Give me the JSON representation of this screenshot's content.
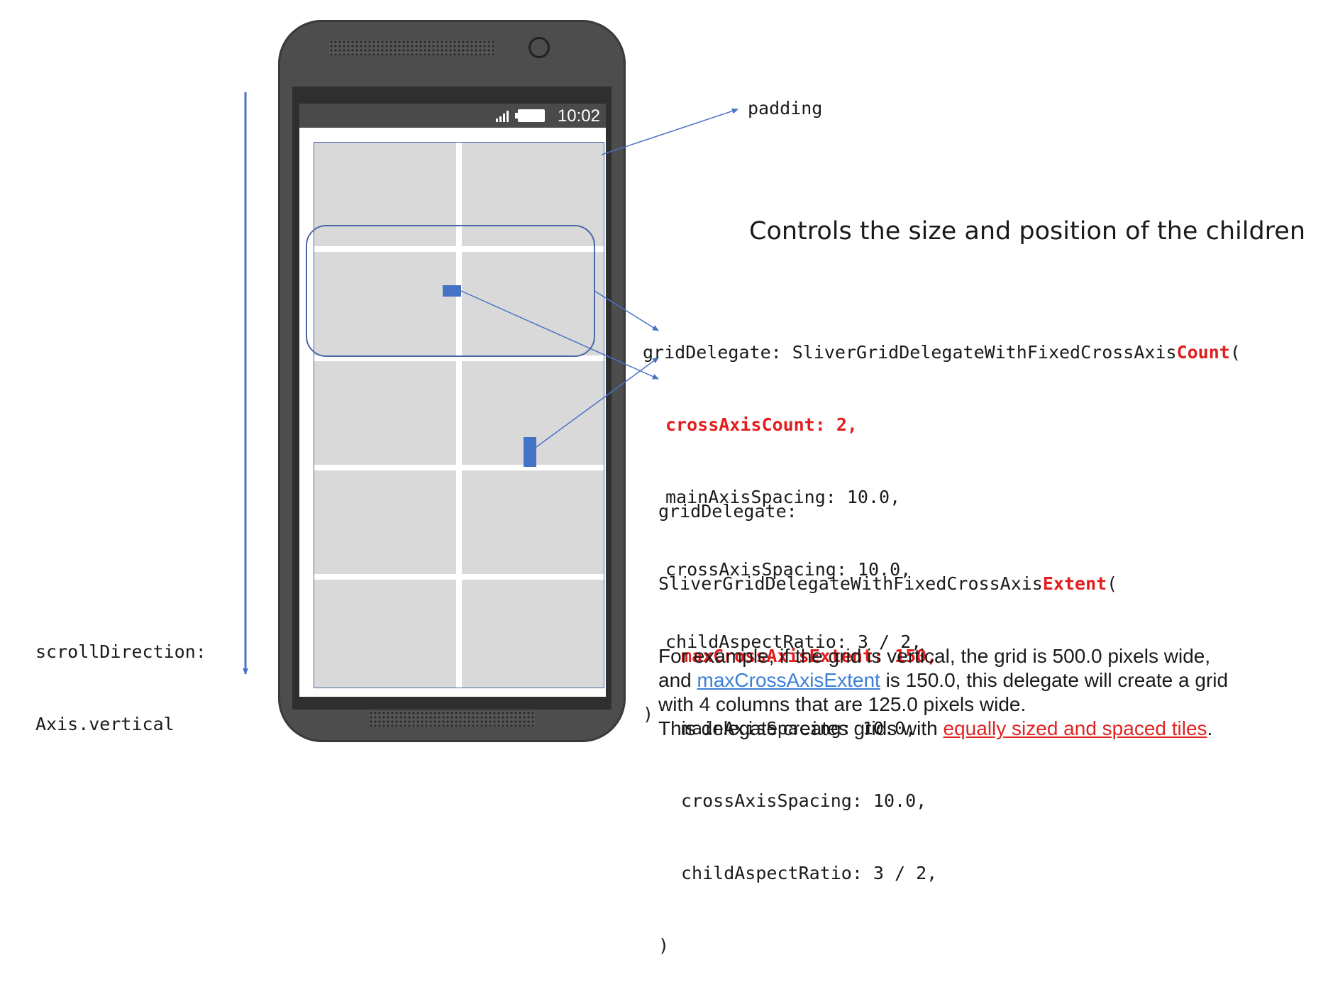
{
  "phone": {
    "status_time": "10:02"
  },
  "labels": {
    "padding": "padding",
    "heading": "Controls the size and position of the children",
    "scroll_line1": "scrollDirection:",
    "scroll_line2": "Axis.vertical"
  },
  "code_count": {
    "l1_a": "gridDelegate: SliverGridDelegateWithFixedCrossAxis",
    "l1_b": "Count",
    "l1_c": "(",
    "l2": "crossAxisCount: 2,",
    "l3": "mainAxisSpacing: 10.0,",
    "l4": "crossAxisSpacing: 10.0,",
    "l5": "childAspectRatio: 3 / 2,",
    "l6": ")"
  },
  "code_extent": {
    "l1": "gridDelegate:",
    "l2_a": "SliverGridDelegateWithFixedCrossAxis",
    "l2_b": "Extent",
    "l2_c": "(",
    "l3": "maxCrossAxisExtent: 150,",
    "l4": "mainAxisSpacing: 10.0,",
    "l5": "crossAxisSpacing: 10.0,",
    "l6": "childAspectRatio: 3 / 2,",
    "l7": ")"
  },
  "description": {
    "line1": "For example, if the grid is vertical, the grid is 500.0 pixels wide,",
    "line2_a": "and ",
    "line2_link": "maxCrossAxisExtent",
    "line2_b": " is 150.0, this delegate will create a grid",
    "line3": "with 4 columns that are 125.0 pixels wide.",
    "line4_a": "This delegate creates grids with ",
    "line4_link": "equally sized and spaced tiles",
    "line4_b": "."
  },
  "colors": {
    "accent_blue": "#4a72c4",
    "code_red": "#e21d1d",
    "tile_gray": "#d9d9d9",
    "phone_body": "#4d4d4d"
  }
}
